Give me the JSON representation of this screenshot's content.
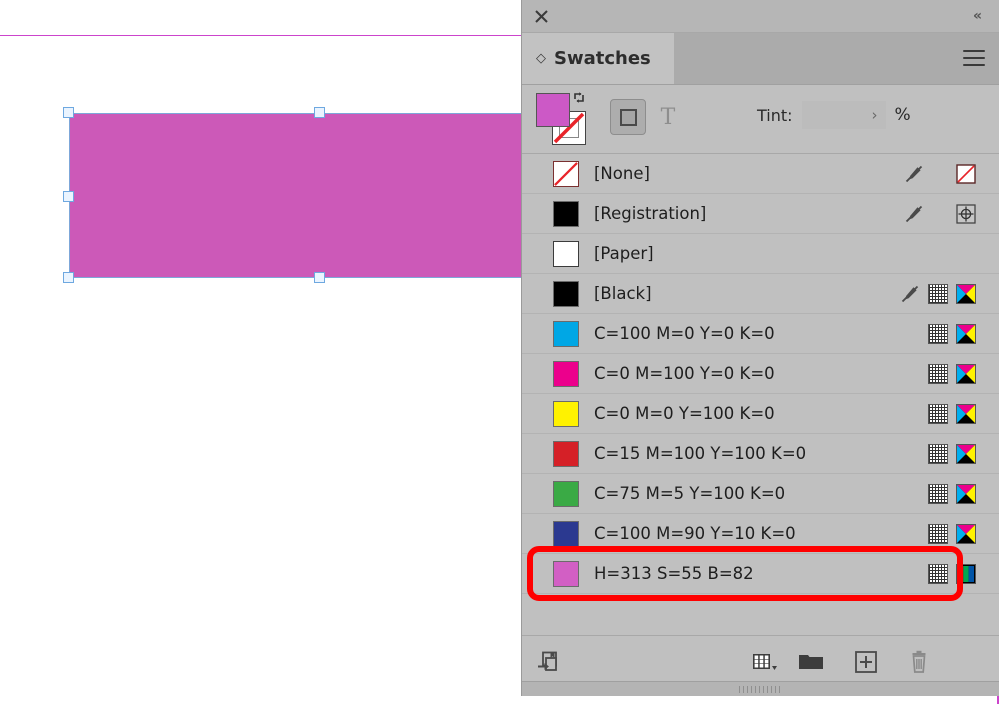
{
  "canvas": {
    "shape_fill_color": "#cc59b8",
    "selection_border_color": "#7da7d9",
    "guide_color": "#cc44cc",
    "background": "#ffffff"
  },
  "panel": {
    "close_icon": "close-icon",
    "collapse_icon": "«",
    "tab_label": "Swatches",
    "tab_diamond": "◇",
    "menu_icon": "panel-menu-icon"
  },
  "toolbar": {
    "fill_color": "#cc59c6",
    "stroke_color": "#ffffff",
    "stroke_is_none": true,
    "swap_arrow": "⇄",
    "format_container_label": "formatting-affects-container",
    "format_text_label": "T",
    "tint_label": "Tint:",
    "tint_value": "",
    "tint_placeholder": "",
    "tint_stepper": "›",
    "tint_percent": "%"
  },
  "swatches": [
    {
      "name": "[None]",
      "chip_type": "none",
      "chip_color": "#ffffff",
      "has_lock_icon": true,
      "has_pattern_icon": false,
      "color_mode_icon": "none-swatch-icon"
    },
    {
      "name": "[Registration]",
      "chip_type": "solid",
      "chip_color": "#000000",
      "has_lock_icon": true,
      "has_pattern_icon": false,
      "color_mode_icon": "registration-icon"
    },
    {
      "name": "[Paper]",
      "chip_type": "solid",
      "chip_color": "#ffffff",
      "has_lock_icon": false,
      "has_pattern_icon": false,
      "color_mode_icon": null
    },
    {
      "name": "[Black]",
      "chip_type": "solid",
      "chip_color": "#000000",
      "has_lock_icon": true,
      "has_pattern_icon": true,
      "color_mode_icon": "cmyk-icon"
    },
    {
      "name": "C=100 M=0 Y=0 K=0",
      "chip_type": "solid",
      "chip_color": "#00a7e5",
      "has_lock_icon": false,
      "has_pattern_icon": true,
      "color_mode_icon": "cmyk-icon"
    },
    {
      "name": "C=0 M=100 Y=0 K=0",
      "chip_type": "solid",
      "chip_color": "#ec008c",
      "has_lock_icon": false,
      "has_pattern_icon": true,
      "color_mode_icon": "cmyk-icon"
    },
    {
      "name": "C=0 M=0 Y=100 K=0",
      "chip_type": "solid",
      "chip_color": "#fff200",
      "has_lock_icon": false,
      "has_pattern_icon": true,
      "color_mode_icon": "cmyk-icon"
    },
    {
      "name": "C=15 M=100 Y=100 K=0",
      "chip_type": "solid",
      "chip_color": "#d52027",
      "has_lock_icon": false,
      "has_pattern_icon": true,
      "color_mode_icon": "cmyk-icon"
    },
    {
      "name": "C=75 M=5 Y=100 K=0",
      "chip_type": "solid",
      "chip_color": "#3aaa45",
      "has_lock_icon": false,
      "has_pattern_icon": true,
      "color_mode_icon": "cmyk-icon"
    },
    {
      "name": "C=100 M=90 Y=10 K=0",
      "chip_type": "solid",
      "chip_color": "#2b3990",
      "has_lock_icon": false,
      "has_pattern_icon": true,
      "color_mode_icon": "cmyk-icon"
    },
    {
      "name": "H=313 S=55 B=82",
      "chip_type": "solid",
      "chip_color": "#d25fc4",
      "has_lock_icon": false,
      "has_pattern_icon": true,
      "color_mode_icon": "rgb-icon"
    }
  ],
  "footer": {
    "add_to_library": "add-to-cc-library",
    "new_color_group": "new-color-group",
    "new_swatch_folder": "new-color-group-folder",
    "new_swatch": "new-swatch",
    "delete_swatch": "delete-swatch"
  },
  "annotation": {
    "highlight_color": "#ff0000",
    "highlighted_swatch": "H=313 S=55 B=82"
  }
}
